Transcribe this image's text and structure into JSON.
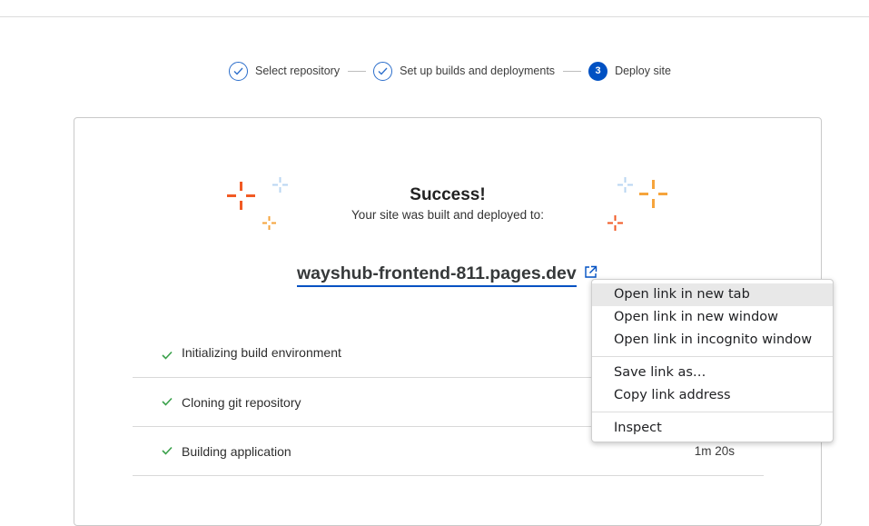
{
  "stepper": {
    "steps": [
      {
        "label": "Select repository",
        "state": "complete"
      },
      {
        "label": "Set up builds and deployments",
        "state": "complete"
      },
      {
        "label": "Deploy site",
        "number": "3",
        "state": "active"
      }
    ]
  },
  "card": {
    "title": "Success!",
    "subtitle": "Your site was built and deployed to:",
    "site_url": "wayshub-frontend-811.pages.dev",
    "build_steps": [
      {
        "label": "Initializing build environment",
        "time": ""
      },
      {
        "label": "Cloning git repository",
        "time": ""
      },
      {
        "label": "Building application",
        "time": "1m 20s"
      }
    ]
  },
  "context_menu": {
    "groups": [
      [
        "Open link in new tab",
        "Open link in new window",
        "Open link in incognito window"
      ],
      [
        "Save link as…",
        "Copy link address"
      ],
      [
        "Inspect"
      ]
    ],
    "highlighted": "Open link in new tab"
  },
  "colors": {
    "accent": "#0051c3",
    "success_check": "#3aa14b",
    "spark_red": "#f15a24",
    "spark_orange": "#f6a43c",
    "spark_blue": "#b9d6f2"
  }
}
